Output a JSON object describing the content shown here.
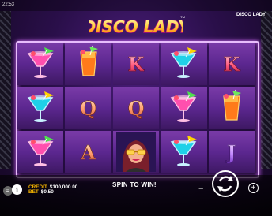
{
  "status": {
    "clock": "22:53",
    "game_name": "DISCO LADY"
  },
  "logo": {
    "text": "DISCO LADY",
    "tm": "TM"
  },
  "reels": [
    [
      "pink-cocktail",
      "blue-cocktail",
      "pink-cocktail"
    ],
    [
      "orange-cocktail",
      "Q",
      "A"
    ],
    [
      "K",
      "Q",
      "disco-lady"
    ],
    [
      "blue-cocktail",
      "pink-cocktail",
      "blue-cocktail"
    ],
    [
      "K",
      "orange-cocktail",
      "J"
    ]
  ],
  "bottom": {
    "credit_label": "CREDIT",
    "credit_value": "$100,000.00",
    "bet_label": "BET",
    "bet_value": "$0.50",
    "spin_prompt": "SPIN TO WIN!",
    "minus_label": "−",
    "plus_label": "+"
  },
  "colors": {
    "credit_label": "#f5b400",
    "frame": "#e8bdfc"
  }
}
